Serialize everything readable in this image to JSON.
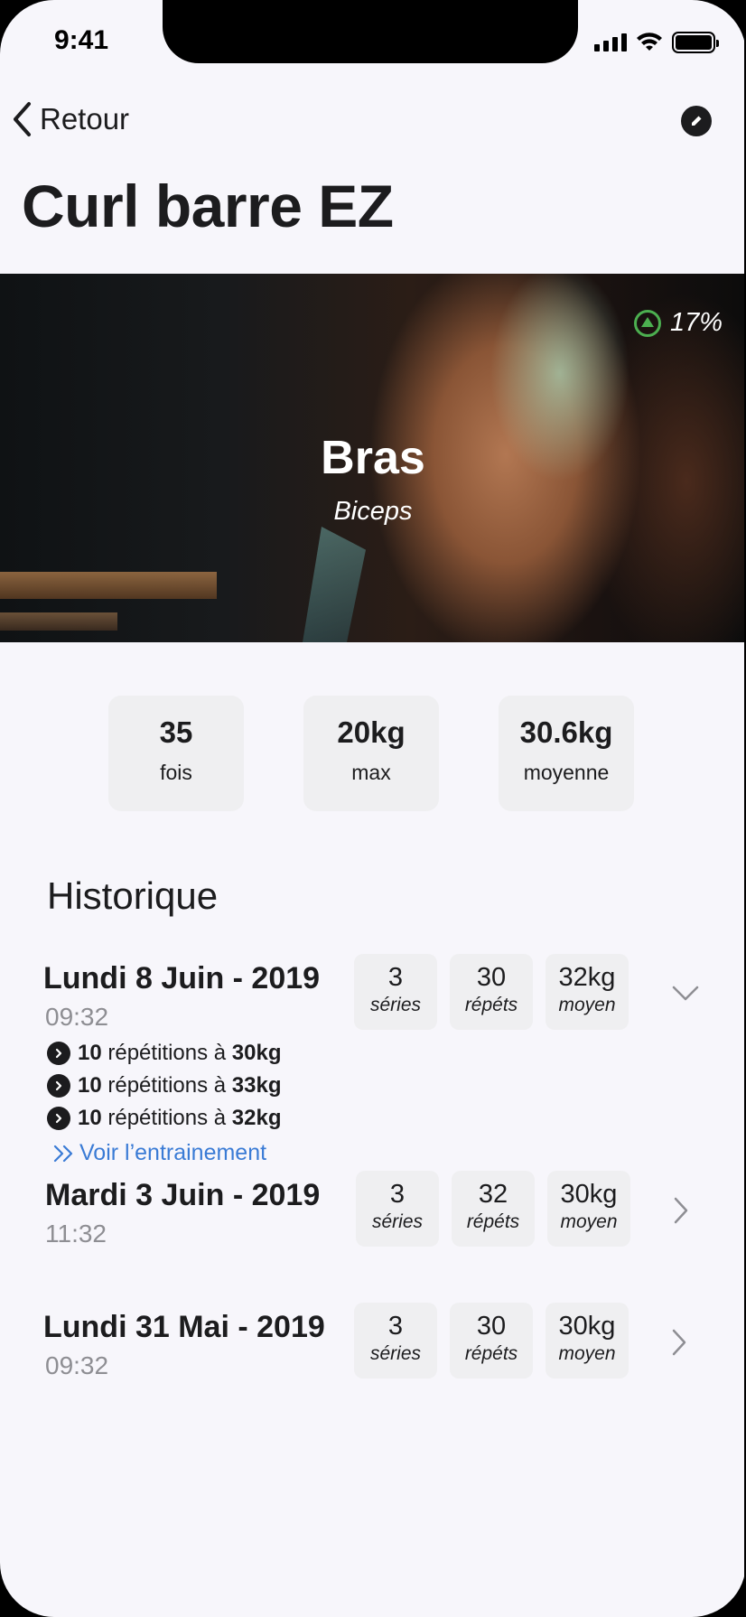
{
  "status_bar": {
    "time": "9:41"
  },
  "nav": {
    "back_label": "Retour"
  },
  "title": "Curl barre EZ",
  "hero": {
    "title": "Bras",
    "subtitle": "Biceps",
    "progress_label": "17%"
  },
  "stats": [
    {
      "value": "35",
      "label": "fois"
    },
    {
      "value": "20kg",
      "label": "max"
    },
    {
      "value": "30.6kg",
      "label": "moyenne"
    }
  ],
  "history": {
    "title": "Historique",
    "entries": [
      {
        "date": "Lundi 8 Juin - 2019",
        "time": "09:32",
        "series": "3",
        "series_label": "séries",
        "reps": "30",
        "reps_label": "répéts",
        "avg": "32kg",
        "avg_label": "moyen",
        "expanded": true,
        "sets": [
          {
            "reps": "10",
            "text": " répétitions à ",
            "weight": "30kg"
          },
          {
            "reps": "10",
            "text": " répétitions à ",
            "weight": "33kg"
          },
          {
            "reps": "10",
            "text": " répétitions à ",
            "weight": "32kg"
          }
        ],
        "link": "Voir l’entrainement"
      },
      {
        "date": "Mardi 3 Juin - 2019",
        "time": "11:32",
        "series": "3",
        "series_label": "séries",
        "reps": "32",
        "reps_label": "répéts",
        "avg": "30kg",
        "avg_label": "moyen",
        "expanded": false
      },
      {
        "date": "Lundi 31 Mai - 2019",
        "time": "09:32",
        "series": "3",
        "series_label": "séries",
        "reps": "30",
        "reps_label": "répéts",
        "avg": "30kg",
        "avg_label": "moyen",
        "expanded": false
      }
    ]
  },
  "icons": {
    "back": "chevron-left-icon",
    "edit": "pencil-icon",
    "progress": "arrow-up-circle-icon",
    "expand": "chevron-down-icon",
    "open": "chevron-right-icon",
    "bullet": "chevron-right-circle-icon",
    "link": "double-chevron-right-icon",
    "wifi": "wifi-icon",
    "signal": "signal-icon",
    "battery": "battery-icon"
  },
  "colors": {
    "accent_link": "#3a7bd5",
    "progress_green": "#4caf50",
    "text": "#1c1c1e",
    "muted": "#8e8e93"
  }
}
